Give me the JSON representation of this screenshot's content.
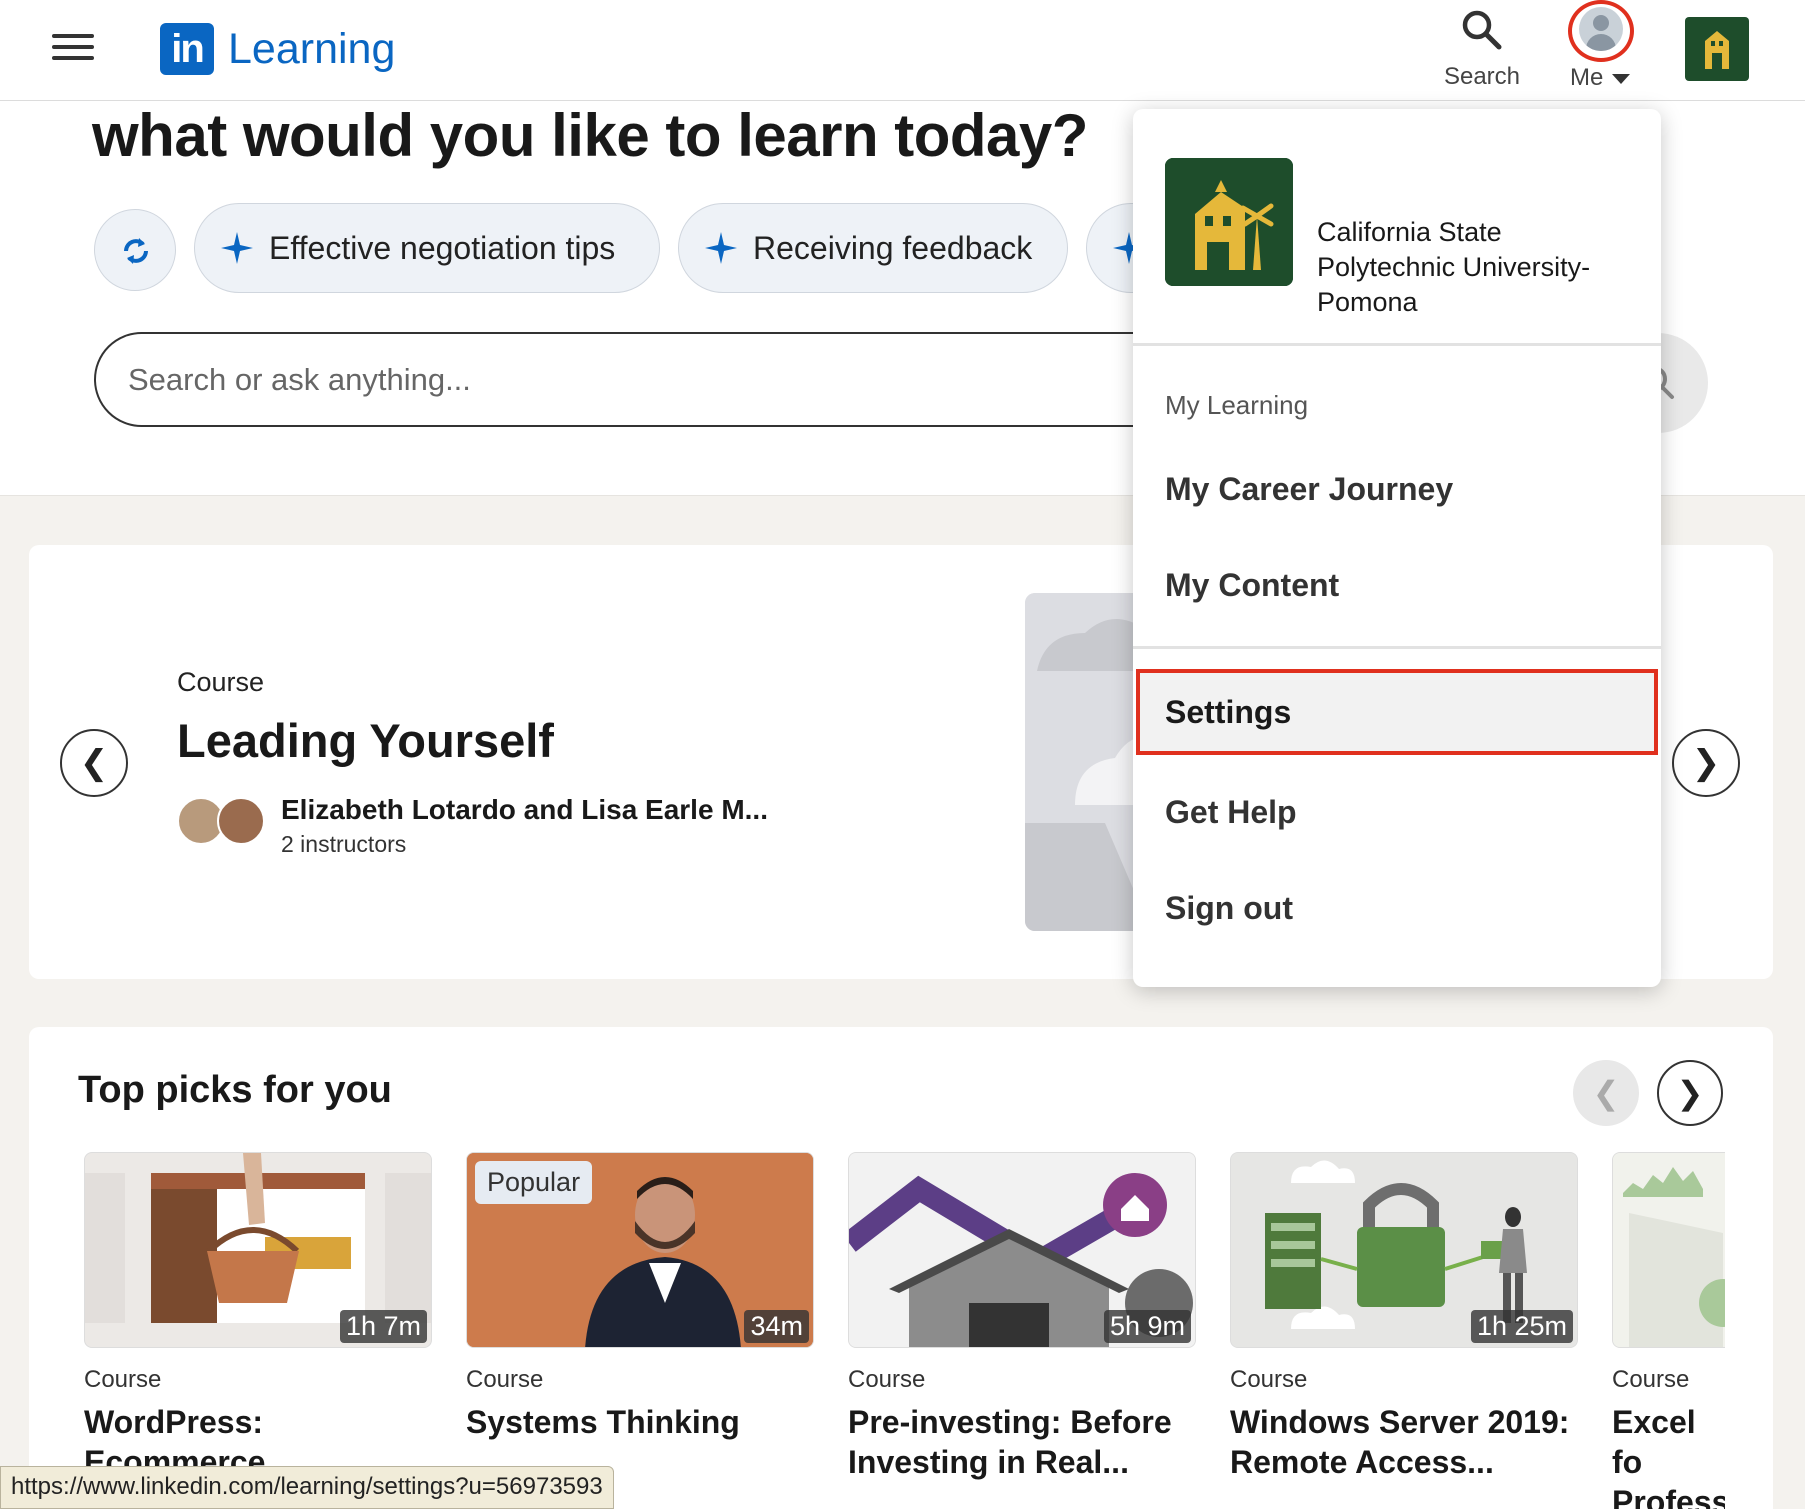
{
  "header": {
    "logo_mark": "in",
    "logo_text": "Learning",
    "search_label": "Search",
    "me_label": "Me"
  },
  "hero": {
    "title": "what would you like to learn today?",
    "chips": [
      "Effective negotiation tips",
      "Receiving feedback"
    ],
    "search_placeholder": "Search or ask anything..."
  },
  "featured": {
    "kind": "Course",
    "title": "Leading Yourself",
    "instructors": "Elizabeth Lotardo and Lisa Earle M...",
    "instructor_count": "2 instructors"
  },
  "top_picks": {
    "title": "Top picks for you",
    "cards": [
      {
        "kind": "Course",
        "title": "WordPress: Ecommerce",
        "duration": "1h 7m",
        "badge": ""
      },
      {
        "kind": "Course",
        "title": "Systems Thinking",
        "duration": "34m",
        "badge": "Popular"
      },
      {
        "kind": "Course",
        "title": "Pre-investing: Before Investing in Real...",
        "duration": "5h 9m",
        "badge": ""
      },
      {
        "kind": "Course",
        "title": "Windows Server 2019: Remote Access...",
        "duration": "1h 25m",
        "badge": ""
      },
      {
        "kind": "Course",
        "title": "Excel fo Profess",
        "duration": "",
        "badge": ""
      }
    ]
  },
  "dropdown": {
    "org_name": "California State Polytechnic University-Pomona",
    "section_label": "My Learning",
    "items": [
      "My Career Journey",
      "My Content"
    ],
    "settings": "Settings",
    "help": "Get Help",
    "signout": "Sign out"
  },
  "statusbar": {
    "url": "https://www.linkedin.com/learning/settings?u=56973593"
  },
  "colors": {
    "brand": "#0a66c2",
    "org_green": "#1e4d2b",
    "org_gold": "#e5b83a",
    "highlight": "#e0301e"
  }
}
